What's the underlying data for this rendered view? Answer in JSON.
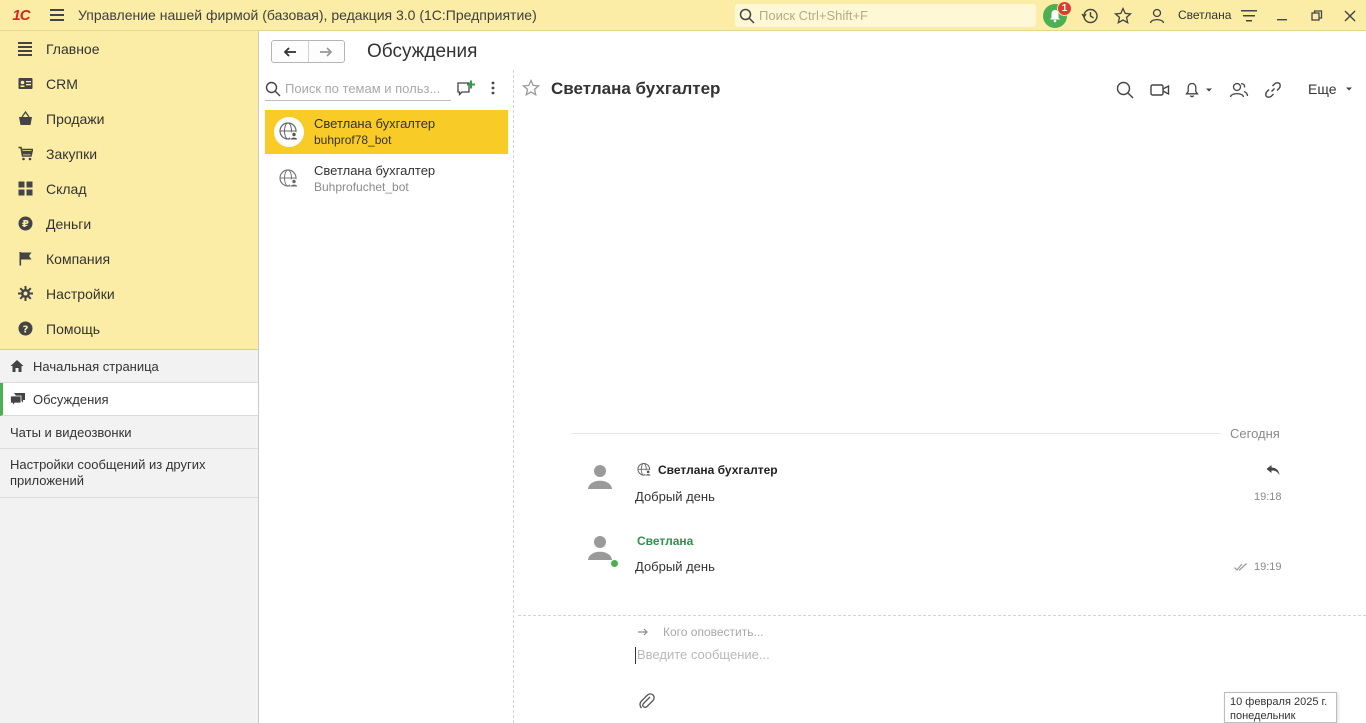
{
  "titlebar": {
    "logo": "1С",
    "app_title": "Управление нашей фирмой (базовая), редакция 3.0  (1С:Предприятие)",
    "search_placeholder": "Поиск Ctrl+Shift+F",
    "notification_count": "1",
    "username": "Светлана"
  },
  "sections": [
    {
      "label": "Главное",
      "icon": "menu-lines-icon"
    },
    {
      "label": "CRM",
      "icon": "crm-card-icon"
    },
    {
      "label": "Продажи",
      "icon": "sales-basket-icon"
    },
    {
      "label": "Закупки",
      "icon": "purchase-cart-icon"
    },
    {
      "label": "Склад",
      "icon": "warehouse-grid-icon"
    },
    {
      "label": "Деньги",
      "icon": "money-ruble-icon"
    },
    {
      "label": "Компания",
      "icon": "company-flag-icon"
    },
    {
      "label": "Настройки",
      "icon": "gear-icon"
    },
    {
      "label": "Помощь",
      "icon": "help-icon"
    }
  ],
  "open_items": {
    "home": "Начальная страница",
    "discussions": "Обсуждения",
    "chats": "Чаты и видеозвонки",
    "settings_line1": "Настройки сообщений из других",
    "settings_line2": "приложений"
  },
  "content": {
    "page_title": "Обсуждения"
  },
  "chatlist": {
    "search_placeholder": "Поиск по темам и польз...",
    "items": [
      {
        "name": "Светлана бухгалтер",
        "sub": "buhprof78_bot",
        "selected": true
      },
      {
        "name": "Светлана бухгалтер",
        "sub": "Buhprofuchet_bot",
        "selected": false
      }
    ]
  },
  "chat": {
    "title": "Светлана бухгалтер",
    "more_label": "Еще",
    "today_label": "Сегодня",
    "messages": [
      {
        "author": "Светлана бухгалтер",
        "text": "Добрый день",
        "time": "19:18"
      },
      {
        "author": "Светлана",
        "text": "Добрый день",
        "time": "19:19"
      }
    ],
    "notify_placeholder": "Кого оповестить...",
    "message_placeholder": "Введите сообщение...",
    "date_tooltip_line1": "10 февраля 2025 г.",
    "date_tooltip_line2": "понедельник"
  },
  "colors": {
    "header_bg": "#fbeda5",
    "selected_bg": "#f9cb26",
    "accent_green": "#4caf50",
    "badge_red": "#e03b2e"
  }
}
